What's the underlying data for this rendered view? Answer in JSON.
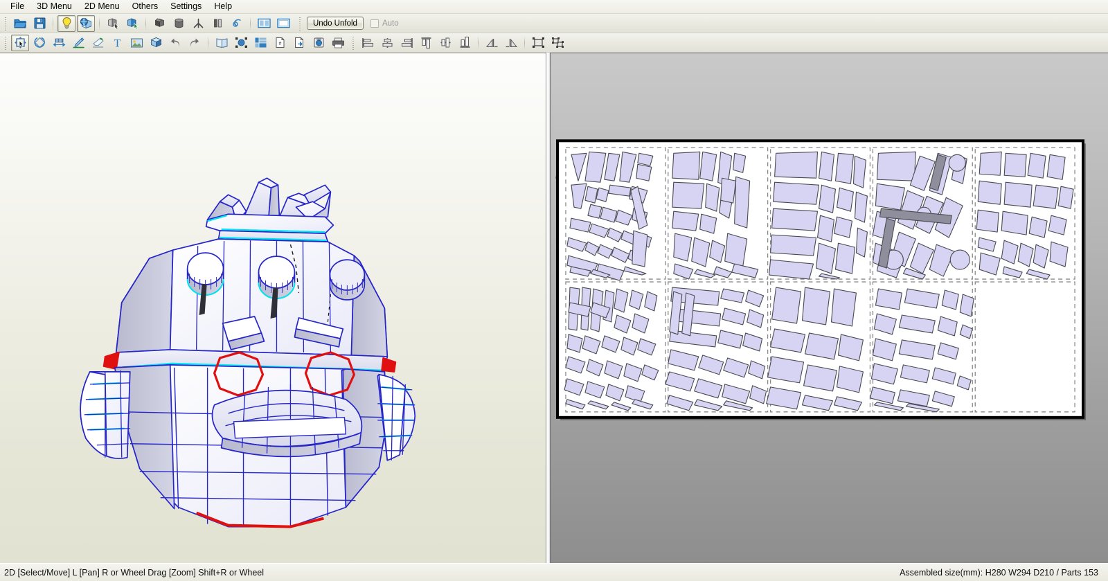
{
  "menu": {
    "items": [
      {
        "id": "file",
        "label": "File"
      },
      {
        "id": "menu3d",
        "label": "3D Menu"
      },
      {
        "id": "menu2d",
        "label": "2D Menu"
      },
      {
        "id": "others",
        "label": "Others"
      },
      {
        "id": "settings",
        "label": "Settings"
      },
      {
        "id": "help",
        "label": "Help"
      }
    ]
  },
  "toolbar_row1": {
    "undo_label": "Undo Unfold",
    "auto_label": "Auto",
    "buttons": [
      {
        "id": "open",
        "icon": "open-folder-icon",
        "active": false
      },
      {
        "id": "save",
        "icon": "save-floppy-icon",
        "active": false
      },
      {
        "id": "light",
        "icon": "lightbulb-icon",
        "active": true
      },
      {
        "id": "texture",
        "icon": "texture-globe-box-icon",
        "active": true
      },
      {
        "id": "select-face",
        "icon": "select-face-icon",
        "active": false
      },
      {
        "id": "select-part",
        "icon": "select-part-icon",
        "active": false
      },
      {
        "id": "join-face",
        "icon": "join-face-icon",
        "active": false
      },
      {
        "id": "cylinder",
        "icon": "cylinder-icon",
        "active": false
      },
      {
        "id": "open-edge",
        "icon": "open-edge-icon",
        "active": false
      },
      {
        "id": "flat-fold",
        "icon": "flat-fold-icon",
        "active": false
      },
      {
        "id": "mirror",
        "icon": "mirror-icon",
        "active": false
      },
      {
        "id": "rotate-view",
        "icon": "rotate-view-icon",
        "active": false
      },
      {
        "id": "split-view",
        "icon": "split-view-icon",
        "active": false
      },
      {
        "id": "single-view",
        "icon": "single-view-icon",
        "active": false
      }
    ]
  },
  "toolbar_row2": {
    "buttons": [
      {
        "id": "select-move",
        "icon": "select-move-icon",
        "active": true
      },
      {
        "id": "rotate-part",
        "icon": "rotate-part-icon",
        "active": false
      },
      {
        "id": "scale-part",
        "icon": "scale-measure-icon",
        "active": false
      },
      {
        "id": "edit-line",
        "icon": "pencil-line-icon",
        "active": false
      },
      {
        "id": "erase-line",
        "icon": "eraser-icon",
        "active": false
      },
      {
        "id": "add-text",
        "icon": "text-tool-icon",
        "active": false
      },
      {
        "id": "add-image",
        "icon": "image-tool-icon",
        "active": false
      },
      {
        "id": "3d-box",
        "icon": "cube-icon",
        "active": false
      },
      {
        "id": "undo",
        "icon": "undo-arrow-icon",
        "active": false
      },
      {
        "id": "redo",
        "icon": "redo-arrow-icon",
        "active": false
      },
      {
        "id": "unfold",
        "icon": "unfold-book-icon",
        "active": false
      },
      {
        "id": "layout-auto",
        "icon": "auto-layout-icon",
        "active": false
      },
      {
        "id": "layout-grid",
        "icon": "page-layout-icon",
        "active": false
      },
      {
        "id": "page-setup",
        "icon": "page-number-icon",
        "active": false
      },
      {
        "id": "export",
        "icon": "export-page-icon",
        "active": false
      },
      {
        "id": "capture",
        "icon": "camera-icon",
        "active": false
      },
      {
        "id": "print",
        "icon": "printer-icon",
        "active": false
      },
      {
        "id": "align-left",
        "icon": "align-left-icon",
        "active": false
      },
      {
        "id": "align-center-h",
        "icon": "align-center-horizontal-icon",
        "active": false
      },
      {
        "id": "align-right",
        "icon": "align-right-icon",
        "active": false
      },
      {
        "id": "align-top",
        "icon": "align-top-icon",
        "active": false
      },
      {
        "id": "align-middle-v",
        "icon": "align-middle-vertical-icon",
        "active": false
      },
      {
        "id": "align-bottom",
        "icon": "align-bottom-icon",
        "active": false
      },
      {
        "id": "flip-horizontal",
        "icon": "flip-horizontal-icon",
        "active": false
      },
      {
        "id": "flip-vertical",
        "icon": "flip-vertical-icon",
        "active": false
      },
      {
        "id": "group",
        "icon": "group-parts-icon",
        "active": false
      },
      {
        "id": "ungroup",
        "icon": "ungroup-parts-icon",
        "active": false
      }
    ]
  },
  "viewport_3d": {
    "name": "3d-model-viewport",
    "model_description": "papercraft robot head model"
  },
  "viewport_2d": {
    "name": "2d-unfold-viewport",
    "pages": {
      "columns": 5,
      "rows": 2,
      "total_cells": 10,
      "empty_cells": 1
    }
  },
  "statusbar": {
    "hint": "2D [Select/Move] L [Pan] R or Wheel Drag [Zoom] Shift+R or Wheel",
    "info": "Assembled size(mm): H280 W294 D210 / Parts 153"
  },
  "colors": {
    "edge_blue": "#2626c8",
    "highlight_cyan": "#00e6ee",
    "marker_red": "#e01010",
    "part_fill": "#d6d4f2",
    "part_stroke": "#4a4a52",
    "pane2d_bg": "#a8a8a8",
    "accent_blue": "#1f6fb4"
  }
}
